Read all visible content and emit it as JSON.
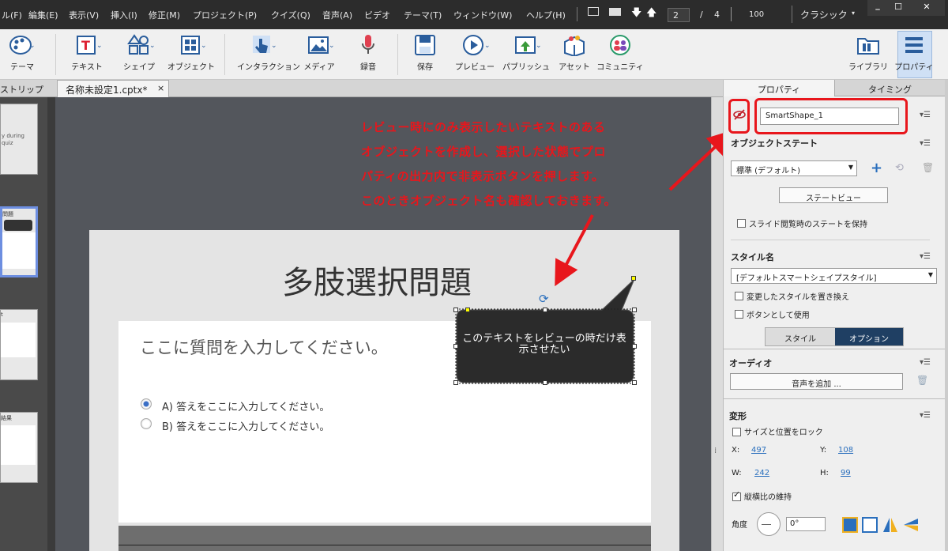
{
  "menubar": {
    "items": [
      "ル(F)",
      "編集(E)",
      "表示(V)",
      "挿入(I)",
      "修正(M)",
      "プロジェクト(P)",
      "クイズ(Q)",
      "音声(A)",
      "ビデオ",
      "テーマ(T)",
      "ウィンドウ(W)",
      "ヘルプ(H)"
    ],
    "page_current": "2",
    "page_sep": "/",
    "page_total": "4",
    "zoom": "100",
    "workspace": "クラシック"
  },
  "toolbar": {
    "items": [
      "テーマ",
      "テキスト",
      "シェイプ",
      "オブジェクト",
      "インタラクション",
      "メディア",
      "録音",
      "保存",
      "プレビュー",
      "パブリッシュ",
      "アセット",
      "コミュニティ"
    ],
    "library": "ライブラリ",
    "properties": "プロパティ"
  },
  "tabs": {
    "filmstrip": "ストリップ",
    "document": "名称未設定1.cptx*",
    "close": "×"
  },
  "filmstrip": {
    "thumb1_text": "y during quiz",
    "thumb2_title": "問題",
    "thumb4_title": "結果"
  },
  "slide": {
    "title": "多肢選択問題",
    "question": "ここに質問を入力してください。",
    "answers": [
      "A) 答えをここに入力してください。",
      "B) 答えをここに入力してください。"
    ],
    "bubble_text": "このテキストをレビューの時だけ表示させたい"
  },
  "annotation": {
    "lines": [
      "レビュー時にのみ表示したいテキストのある",
      "オブジェクトを作成し、選択した状態でプロ",
      "パティの出力内で非表示ボタンを押します。",
      "このときオブジェクト名も確認しておきます。"
    ]
  },
  "panel": {
    "tab_properties": "プロパティ",
    "tab_timing": "タイミング",
    "object_name": "SmartShape_1",
    "object_state_heading": "オブジェクトステート",
    "state_select": "標準 (デフォルト)",
    "state_view_button": "ステートビュー",
    "retain_state_label": "スライド閲覧時のステートを保持",
    "style_name_heading": "スタイル名",
    "style_select": "[デフォルトスマートシェイプスタイル]",
    "replace_style_label": "変更したスタイルを置き換え",
    "use_as_button_label": "ボタンとして使用",
    "segment_style": "スタイル",
    "segment_options": "オプション",
    "audio_heading": "オーディオ",
    "add_audio_button": "音声を追加 ...",
    "transform_heading": "変形",
    "lock_label": "サイズと位置をロック",
    "x_label": "X:",
    "x_value": "497",
    "y_label": "Y:",
    "y_value": "108",
    "w_label": "W:",
    "w_value": "242",
    "h_label": "H:",
    "h_value": "99",
    "aspect_label": "縦横比の維持",
    "angle_label": "角度",
    "angle_value": "0°"
  },
  "colors": {
    "annotation_red": "#e8161c",
    "menubar_bg": "#2c2c2c",
    "toolbar_bg": "#f0f0f0",
    "canvas_bg": "#53565c",
    "accent_blue": "#2a6fbd",
    "segment_active": "#1f3f63"
  }
}
